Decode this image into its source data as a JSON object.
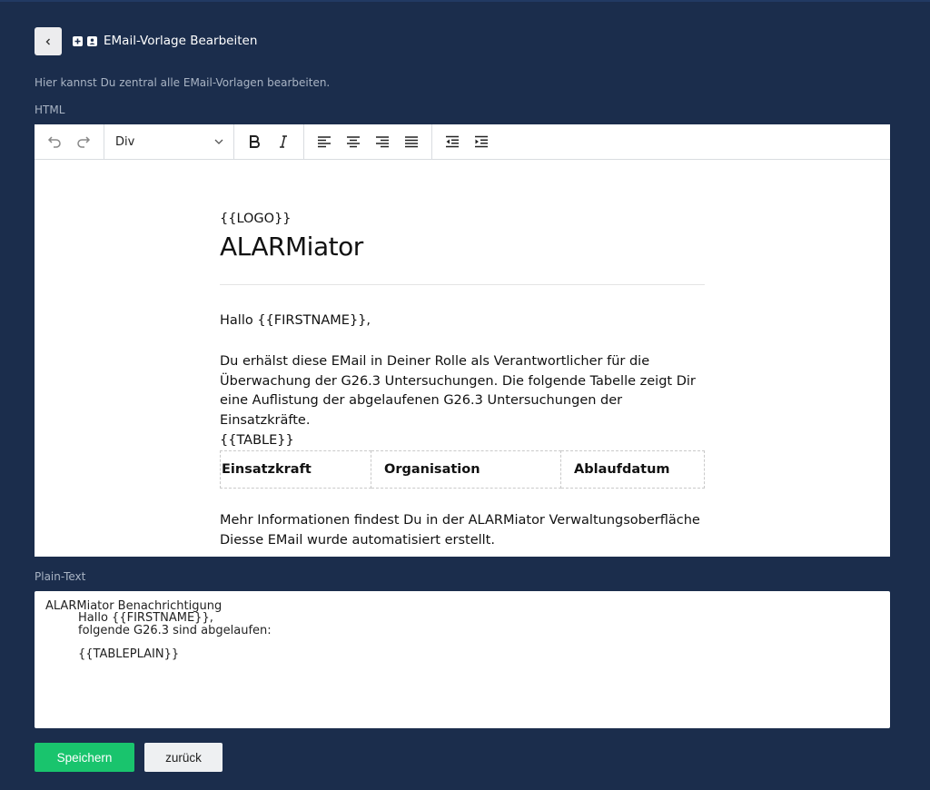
{
  "header": {
    "title": "EMail-Vorlage Bearbeiten",
    "description": "Hier kannst Du zentral alle EMail-Vorlagen bearbeiten."
  },
  "html_section": {
    "label": "HTML",
    "toolbar": {
      "block_format": "Div",
      "buttons": [
        "undo-icon",
        "redo-icon",
        "bold-icon",
        "italic-icon",
        "align-left-icon",
        "align-center-icon",
        "align-right-icon",
        "align-justify-icon",
        "outdent-icon",
        "indent-icon"
      ]
    },
    "content": {
      "logo_placeholder": "{{LOGO}}",
      "brand": "ALARMiator",
      "greeting": "Hallo {{FIRSTNAME}},",
      "paragraph": "Du erhälst diese EMail in Deiner Rolle als Verantwortlicher für die Überwachung der G26.3 Untersuchungen. Die folgende Tabelle zeigt Dir eine Auflistung der abgelaufenen G26.3 Untersuchungen der Einsatzkräfte.",
      "table_placeholder": "{{TABLE}}",
      "table_headers": [
        "Einsatzkraft",
        "Organisation",
        "Ablaufdatum"
      ],
      "info_line1": "Mehr Informationen findest Du in der ALARMiator Verwaltungsoberfläche",
      "info_line2": "Diesse EMail wurde automatisiert erstellt."
    }
  },
  "plain_section": {
    "label": "Plain-Text",
    "lines": [
      "ALARMiator Benachrichtigung",
      "Hallo {{FIRSTNAME}},",
      "folgende G26.3 sind abgelaufen:",
      "{{TABLEPLAIN}}"
    ]
  },
  "actions": {
    "save": "Speichern",
    "back": "zurück"
  },
  "colors": {
    "background": "#1b2d4c",
    "save_button": "#19c46d"
  }
}
